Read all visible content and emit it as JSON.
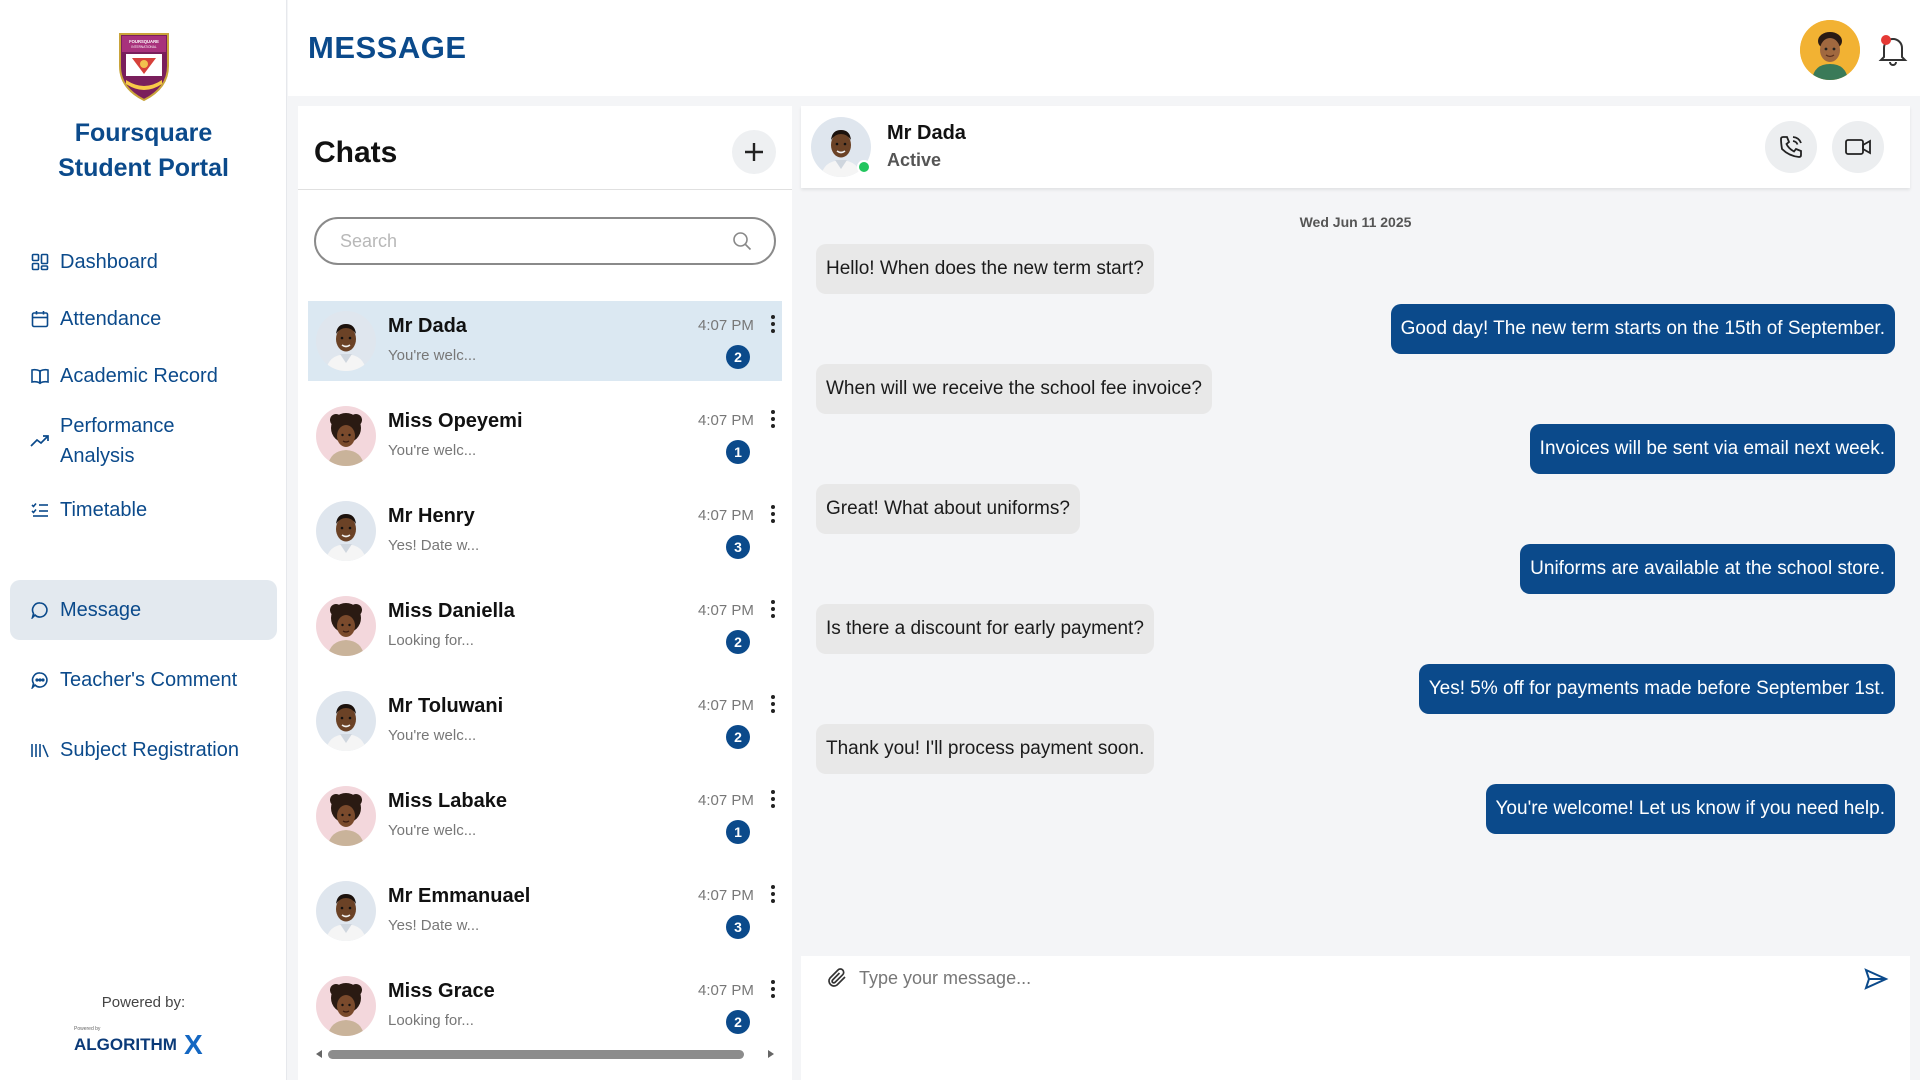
{
  "sidebar": {
    "portal_title_line1": "Foursquare",
    "portal_title_line2": "Student Portal",
    "logo_text": "FOURSQUARE INTERNATIONAL SECONDARY SCHOOL",
    "items": [
      {
        "label": "Dashboard",
        "icon": "grid-icon"
      },
      {
        "label": "Attendance",
        "icon": "calendar-icon"
      },
      {
        "label": "Academic Record",
        "icon": "book-open-icon"
      },
      {
        "label": "Performance",
        "label2": "Analysis",
        "icon": "trending-up-icon"
      },
      {
        "label": "Timetable",
        "icon": "list-check-icon"
      },
      {
        "label": "Message",
        "icon": "chat-bubble-icon",
        "active": true
      },
      {
        "label": "Teacher's Comment",
        "icon": "comment-dots-icon"
      },
      {
        "label": "Subject Registration",
        "icon": "library-icon"
      }
    ],
    "powered_by": "Powered by:",
    "brand_small": "Powered by",
    "brand": "ALGORITHM",
    "brand_x": "X"
  },
  "header": {
    "title": "MESSAGE"
  },
  "chats": {
    "title": "Chats",
    "search_placeholder": "Search",
    "items": [
      {
        "name": "Mr Dada",
        "preview": "You're welc...",
        "time": "4:07 PM",
        "unread": "2",
        "avatar": "male"
      },
      {
        "name": "Miss Opeyemi",
        "preview": "You're welc...",
        "time": "4:07 PM",
        "unread": "1",
        "avatar": "female"
      },
      {
        "name": "Mr Henry",
        "preview": "Yes! Date w...",
        "time": "4:07 PM",
        "unread": "3",
        "avatar": "male"
      },
      {
        "name": "Miss Daniella",
        "preview": "Looking for...",
        "time": "4:07 PM",
        "unread": "2",
        "avatar": "female"
      },
      {
        "name": "Mr Toluwani",
        "preview": "You're welc...",
        "time": "4:07 PM",
        "unread": "2",
        "avatar": "male"
      },
      {
        "name": "Miss Labake",
        "preview": "You're welc...",
        "time": "4:07 PM",
        "unread": "1",
        "avatar": "female"
      },
      {
        "name": "Mr Emmanuael",
        "preview": "Yes! Date w...",
        "time": "4:07 PM",
        "unread": "3",
        "avatar": "male"
      },
      {
        "name": "Miss Grace",
        "preview": "Looking for...",
        "time": "4:07 PM",
        "unread": "2",
        "avatar": "female"
      }
    ]
  },
  "conversation": {
    "contact_name": "Mr Dada",
    "contact_status": "Active",
    "date": "Wed Jun 11 2025",
    "messages": [
      {
        "dir": "in",
        "text": "Hello! When does the new term start?"
      },
      {
        "dir": "out",
        "text": "Good day! The new term starts on the 15th of September."
      },
      {
        "dir": "in",
        "text": "When will we receive the school fee invoice?"
      },
      {
        "dir": "out",
        "text": "Invoices will be sent via email next week."
      },
      {
        "dir": "in",
        "text": "Great! What about uniforms?"
      },
      {
        "dir": "out",
        "text": "Uniforms are available at the school store."
      },
      {
        "dir": "in",
        "text": "Is there a discount for early payment?"
      },
      {
        "dir": "out",
        "text": "Yes! 5% off for payments made before September 1st."
      },
      {
        "dir": "in",
        "text": "Thank you! I'll process payment soon."
      },
      {
        "dir": "out",
        "text": "You're welcome! Let us know if you need help."
      }
    ],
    "composer_placeholder": "Type your message..."
  },
  "colors": {
    "brand_blue": "#0b4a8b",
    "active_nav_bg": "#e3e9ef",
    "active_chat_bg": "#dbe8f2",
    "incoming_bubble": "#e8e8e8",
    "online": "#22c55e",
    "notification": "#e53935"
  }
}
